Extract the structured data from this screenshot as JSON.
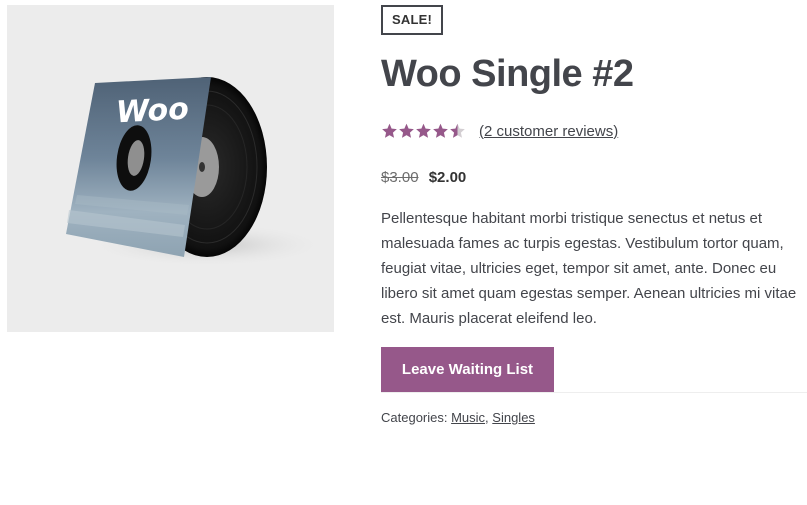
{
  "product": {
    "sale_badge": "SALE!",
    "title": "Woo Single #2",
    "image_alt_text": "Woo",
    "rating": {
      "value": 4.5,
      "max": 5,
      "review_link": "(2 customer reviews)"
    },
    "price": {
      "regular": "$3.00",
      "sale": "$2.00"
    },
    "description": "Pellentesque habitant morbi tristique senectus et netus et malesuada fames ac turpis egestas. Vestibulum tortor quam, feugiat vitae, ultricies eget, tempor sit amet, ante. Donec eu libero sit amet quam egestas semper. Aenean ultricies mi vitae est. Mauris placerat eleifend leo.",
    "button_label": "Leave Waiting List",
    "categories": {
      "label": "Categories:",
      "items": [
        "Music",
        "Singles"
      ],
      "separator": ","
    }
  },
  "colors": {
    "accent": "#96588a",
    "text": "#43454b",
    "image_background": "#ececec"
  }
}
